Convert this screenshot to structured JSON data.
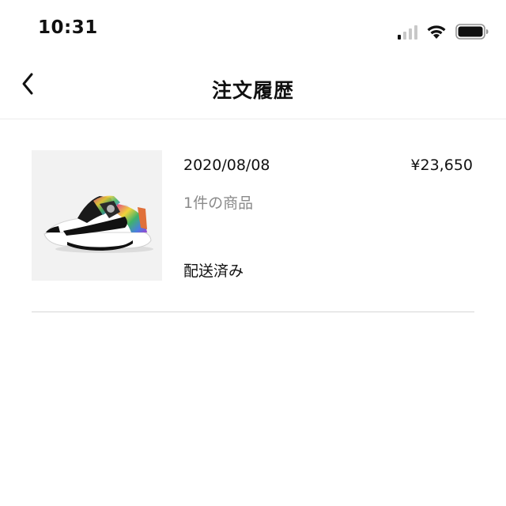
{
  "status_bar": {
    "time": "10:31",
    "signal_icon": "cellular-signal-icon",
    "wifi_icon": "wifi-icon",
    "battery_icon": "battery-icon",
    "signal_bars_active": 1,
    "signal_bars_total": 4
  },
  "header": {
    "title": "注文履歴",
    "back_icon": "chevron-left-icon"
  },
  "orders": [
    {
      "date": "2020/08/08",
      "price": "¥23,650",
      "item_count": "1件の商品",
      "status": "配送済み",
      "thumbnail": "sneaker-product-image"
    }
  ],
  "colors": {
    "text_primary": "#111111",
    "text_secondary": "#8a8a8a",
    "divider": "#d6d6d6",
    "thumb_bg": "#f2f2f2",
    "signal_inactive": "#c8c8c8"
  }
}
